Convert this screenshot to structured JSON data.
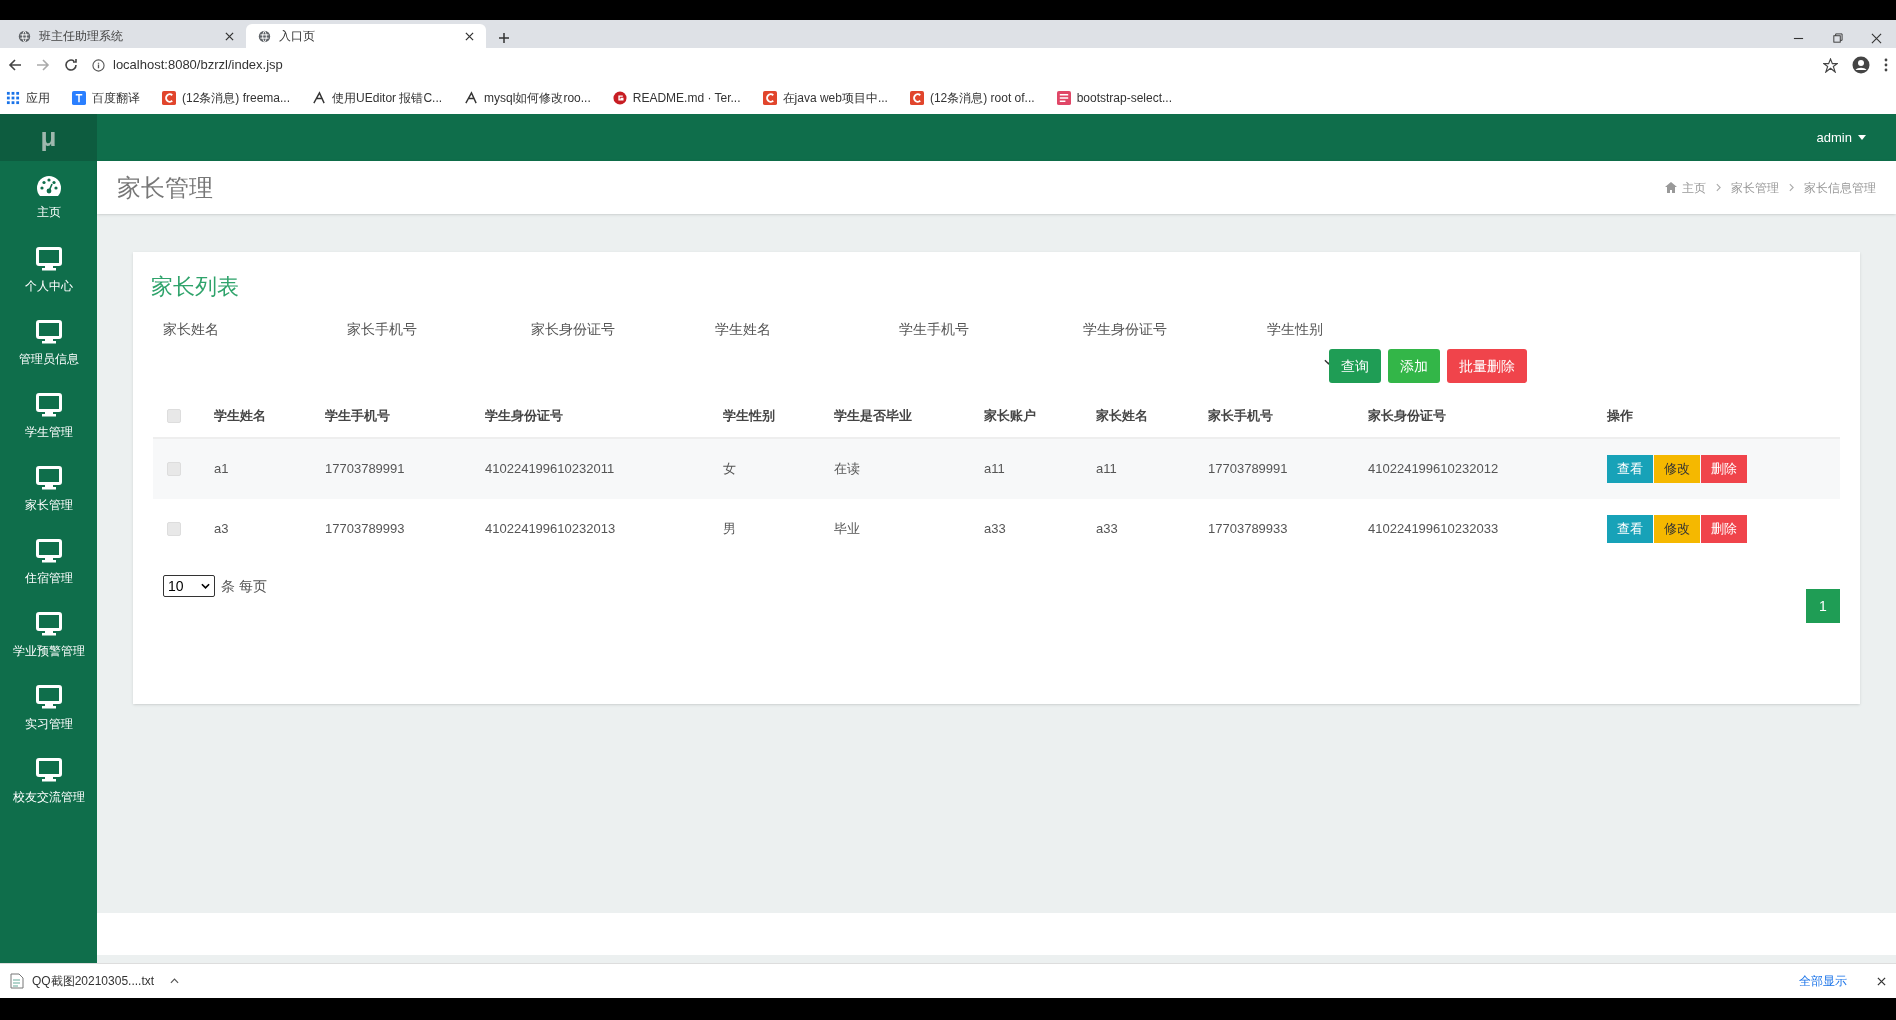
{
  "browser": {
    "tabs": [
      {
        "label": "班主任助理系统",
        "selected": false
      },
      {
        "label": "入口页",
        "selected": true
      }
    ],
    "address": "localhost:8080/bzrzl/index.jsp",
    "bookmarks": [
      {
        "label": "应用",
        "kind": "apps"
      },
      {
        "label": "百度翻译",
        "kind": "blue"
      },
      {
        "label": "(12条消息) freema...",
        "kind": "csdn"
      },
      {
        "label": "使用UEditor 报错C...",
        "kind": "logo"
      },
      {
        "label": "mysql如何修改roo...",
        "kind": "logo"
      },
      {
        "label": "README.md · Ter...",
        "kind": "gitee"
      },
      {
        "label": "在java web项目中...",
        "kind": "csdn"
      },
      {
        "label": "(12条消息) root of...",
        "kind": "csdn"
      },
      {
        "label": "bootstrap-select...",
        "kind": "pink"
      }
    ]
  },
  "topbar": {
    "logo": "μ",
    "user": "admin"
  },
  "sidebar": {
    "items": [
      {
        "label": "主页",
        "kind": "dashboard",
        "selected": false
      },
      {
        "label": "个人中心",
        "kind": "monitor",
        "selected": false
      },
      {
        "label": "管理员信息",
        "kind": "monitor",
        "selected": false
      },
      {
        "label": "学生管理",
        "kind": "monitor",
        "selected": false
      },
      {
        "label": "家长管理",
        "kind": "monitor",
        "selected": false
      },
      {
        "label": "住宿管理",
        "kind": "monitor",
        "selected": false
      },
      {
        "label": "学业预警管理",
        "kind": "monitor",
        "selected": false
      },
      {
        "label": "实习管理",
        "kind": "monitor",
        "selected": false
      },
      {
        "label": "校友交流管理",
        "kind": "monitor",
        "selected": false
      }
    ]
  },
  "page": {
    "title": "家长管理",
    "breadcrumb": [
      "主页",
      "家长管理",
      "家长信息管理"
    ]
  },
  "card": {
    "title": "家长列表",
    "filters": [
      "家长姓名",
      "家长手机号",
      "家长身份证号",
      "学生姓名",
      "学生手机号",
      "学生身份证号",
      "学生性别"
    ],
    "buttons": [
      {
        "label": "查询",
        "kind": "query"
      },
      {
        "label": "添加",
        "kind": "add"
      },
      {
        "label": "批量删除",
        "kind": "delete"
      }
    ],
    "table": {
      "select_all": {
        "checked": false
      },
      "columns": [
        "学生姓名",
        "学生手机号",
        "学生身份证号",
        "学生性别",
        "学生是否毕业",
        "家长账户",
        "家长姓名",
        "家长手机号",
        "家长身份证号",
        "操作"
      ],
      "rows": [
        {
          "checked": false,
          "cells": [
            "a1",
            "17703789991",
            "410224199610232011",
            "女",
            "在读",
            "a11",
            "a11",
            "17703789991",
            "410224199610232012"
          ],
          "actions": [
            {
              "label": "查看",
              "kind": "view"
            },
            {
              "label": "修改",
              "kind": "edit"
            },
            {
              "label": "删除",
              "kind": "delete"
            }
          ]
        },
        {
          "checked": false,
          "cells": [
            "a3",
            "17703789993",
            "410224199610232013",
            "男",
            "毕业",
            "a33",
            "a33",
            "17703789933",
            "410224199610232033"
          ],
          "actions": [
            {
              "label": "查看",
              "kind": "view"
            },
            {
              "label": "修改",
              "kind": "edit"
            },
            {
              "label": "删除",
              "kind": "delete"
            }
          ]
        }
      ]
    },
    "page_size": "10",
    "page_size_label": "条 每页",
    "pages": [
      {
        "label": "1",
        "selected": true
      }
    ]
  },
  "downloads": {
    "file": "QQ截图20210305....txt",
    "show_all": "全部显示"
  }
}
